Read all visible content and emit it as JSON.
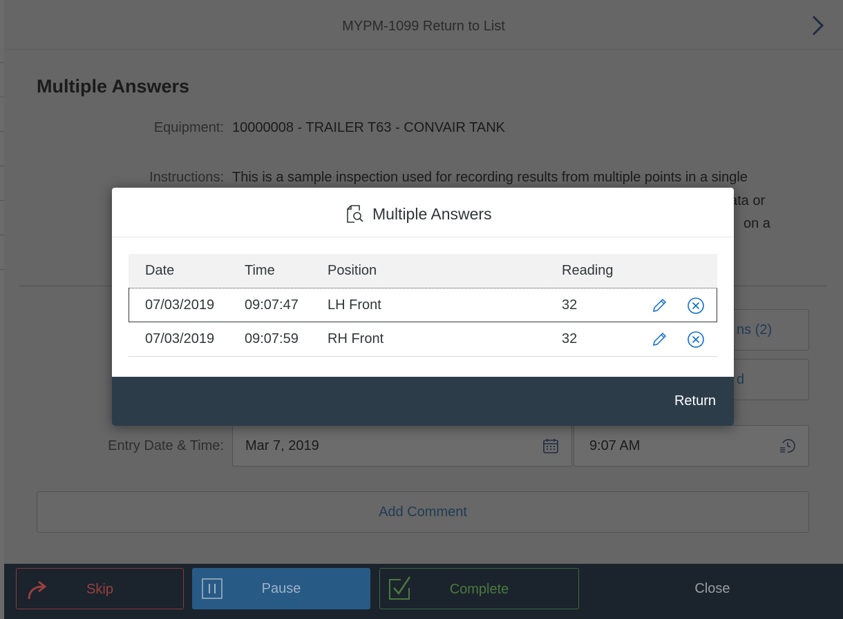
{
  "header": {
    "title": "MYPM-1099 Return to List"
  },
  "page": {
    "heading": "Multiple Answers",
    "equipment_label": "Equipment:",
    "equipment_value": "10000008 - TRAILER T63 - CONVAIR TANK",
    "instructions_label": "Instructions:",
    "instructions_line1": "This is a sample inspection used for recording results from multiple points in a single",
    "instructions_line2_fragment": "ata or",
    "instructions_line3_fragment": "on a",
    "side_button1_fragment": "ns (2)",
    "side_button2_fragment": "d",
    "entry_label": "Entry Date & Time:",
    "entry_date": "Mar 7, 2019",
    "entry_time": "9:07 AM",
    "add_comment": "Add Comment"
  },
  "footer": {
    "skip": "Skip",
    "pause": "Pause",
    "complete": "Complete",
    "close": "Close"
  },
  "dialog": {
    "title": "Multiple Answers",
    "columns": [
      "Date",
      "Time",
      "Position",
      "Reading"
    ],
    "rows": [
      {
        "date": "07/03/2019",
        "time": "09:07:47",
        "position": "LH Front",
        "reading": "32"
      },
      {
        "date": "07/03/2019",
        "time": "09:07:59",
        "position": "RH Front",
        "reading": "32"
      }
    ],
    "return_label": "Return"
  },
  "colors": {
    "dialog_footer": "#2c3c49",
    "footer_bar": "#1b232c",
    "icon_blue": "#0a6ed1"
  }
}
